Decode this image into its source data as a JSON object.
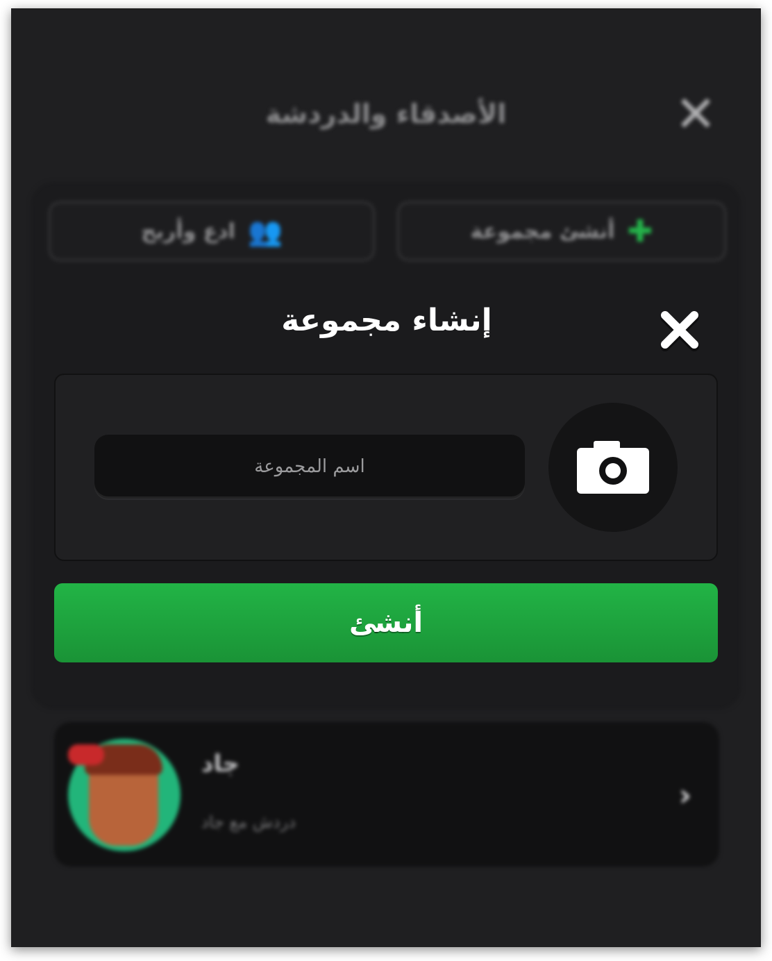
{
  "background": {
    "title": "الأصدقاء والدردشة",
    "buttons": {
      "create_group": "أنشئ مجموعة",
      "add_friend": "ادع وأربح"
    },
    "friend": {
      "name": "جاد",
      "status": "دردش مع جاد"
    }
  },
  "modal": {
    "title": "إنشاء مجموعة",
    "name_placeholder": "اسم المجموعة",
    "name_value": "",
    "create_label": "أنشئ"
  },
  "colors": {
    "accent_green": "#22b446",
    "panel": "#1b1b1d",
    "input_bg": "#111112"
  }
}
